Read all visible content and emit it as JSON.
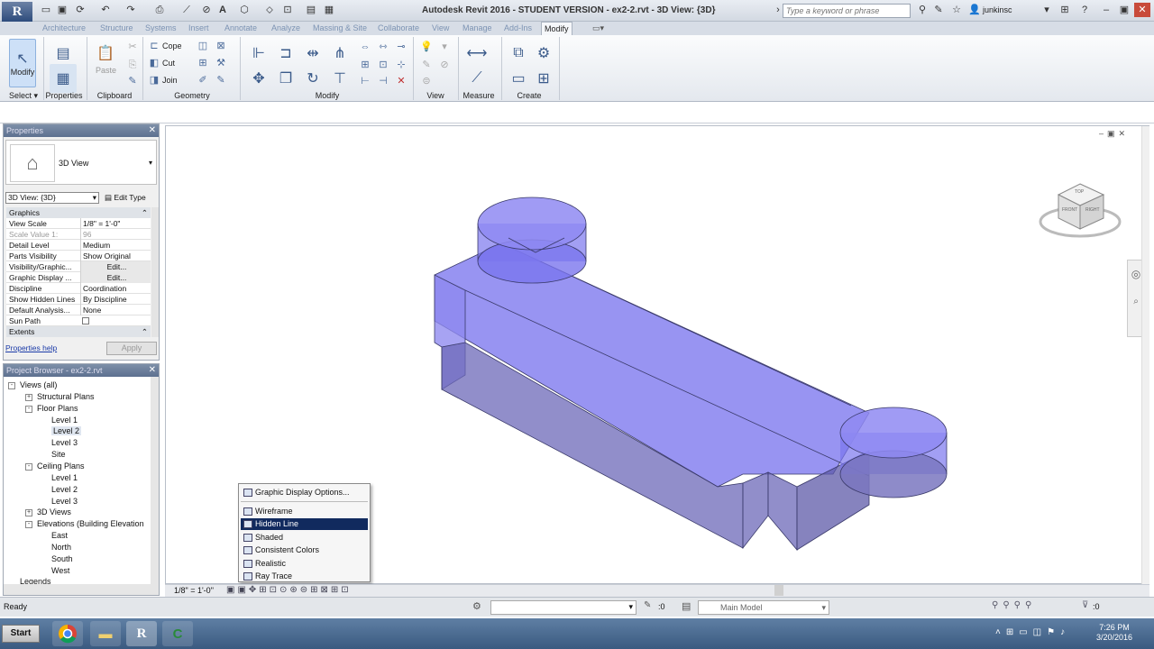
{
  "app": {
    "logo": "R",
    "title": "Autodesk Revit 2016 - STUDENT VERSION -    ex2-2.rvt - 3D View: {3D}",
    "search_placeholder": "Type a keyword or phrase",
    "user": "junkinsc"
  },
  "tabs": [
    "Architecture",
    "Structure",
    "Systems",
    "Insert",
    "Annotate",
    "Analyze",
    "Massing & Site",
    "Collaborate",
    "View",
    "Manage",
    "Add-Ins",
    "Modify"
  ],
  "active_tab": "Modify",
  "ribbon": {
    "modify_label": "Modify",
    "paste_label": "Paste",
    "cope_label": "Cope",
    "cut_label": "Cut",
    "join_label": "Join",
    "panels": {
      "select": "Select",
      "properties": "Properties",
      "clipboard": "Clipboard",
      "geometry": "Geometry",
      "modify": "Modify",
      "view": "View",
      "measure": "Measure",
      "create": "Create"
    }
  },
  "properties": {
    "title": "Properties",
    "type_name": "3D View",
    "instance_selector": "3D View: {3D}",
    "edit_type": "Edit Type",
    "group_graphics": "Graphics",
    "group_extents": "Extents",
    "rows": [
      {
        "key": "View Scale",
        "value": "1/8\" = 1'-0\"",
        "dim": false
      },
      {
        "key": "Scale Value    1:",
        "value": "96",
        "dim": true
      },
      {
        "key": "Detail Level",
        "value": "Medium",
        "dim": false
      },
      {
        "key": "Parts Visibility",
        "value": "Show Original",
        "dim": false
      },
      {
        "key": "Visibility/Graphic...",
        "value": "Edit...",
        "dim": false
      },
      {
        "key": "Graphic Display ...",
        "value": "Edit...",
        "dim": false
      },
      {
        "key": "Discipline",
        "value": "Coordination",
        "dim": false
      },
      {
        "key": "Show Hidden Lines",
        "value": "By Discipline",
        "dim": false
      },
      {
        "key": "Default Analysis...",
        "value": "None",
        "dim": false
      },
      {
        "key": "Sun Path",
        "value": "",
        "dim": false
      }
    ],
    "help_link": "Properties help",
    "apply": "Apply"
  },
  "browser": {
    "title": "Project Browser - ex2-2.rvt",
    "nodes": [
      {
        "label": "Views (all)",
        "level": 0,
        "toggle": "-"
      },
      {
        "label": "Structural Plans",
        "level": 1,
        "toggle": "+"
      },
      {
        "label": "Floor Plans",
        "level": 1,
        "toggle": "-"
      },
      {
        "label": "Level 1",
        "level": 2,
        "toggle": ""
      },
      {
        "label": "Level 2",
        "level": 2,
        "toggle": "",
        "selected": true
      },
      {
        "label": "Level 3",
        "level": 2,
        "toggle": ""
      },
      {
        "label": "Site",
        "level": 2,
        "toggle": ""
      },
      {
        "label": "Ceiling Plans",
        "level": 1,
        "toggle": "-"
      },
      {
        "label": "Level 1",
        "level": 2,
        "toggle": ""
      },
      {
        "label": "Level 2",
        "level": 2,
        "toggle": ""
      },
      {
        "label": "Level 3",
        "level": 2,
        "toggle": ""
      },
      {
        "label": "3D Views",
        "level": 1,
        "toggle": "+"
      },
      {
        "label": "Elevations (Building Elevation",
        "level": 1,
        "toggle": "-"
      },
      {
        "label": "East",
        "level": 2,
        "toggle": ""
      },
      {
        "label": "North",
        "level": 2,
        "toggle": ""
      },
      {
        "label": "South",
        "level": 2,
        "toggle": ""
      },
      {
        "label": "West",
        "level": 2,
        "toggle": ""
      },
      {
        "label": "Legends",
        "level": 0,
        "toggle": ""
      }
    ]
  },
  "viewcube": {
    "top": "TOP",
    "front": "FRONT",
    "right": "RIGHT"
  },
  "visual_style_menu": {
    "header": "Graphic Display Options...",
    "items": [
      "Wireframe",
      "Hidden Line",
      "Shaded",
      "Consistent Colors",
      "Realistic",
      "Ray Trace"
    ],
    "highlighted": "Hidden Line"
  },
  "view_control_bar": {
    "scale": "1/8\" = 1'-0\""
  },
  "status": {
    "text": "Ready",
    "worksets": ":0",
    "model": "Main Model",
    "filter": ":0"
  },
  "taskbar": {
    "start": "Start",
    "time": "7:26 PM",
    "date": "3/20/2016"
  },
  "colors": {
    "model_fill": "#7b76ee",
    "selection": "#112a5e",
    "palette_header": "#6d809c"
  }
}
